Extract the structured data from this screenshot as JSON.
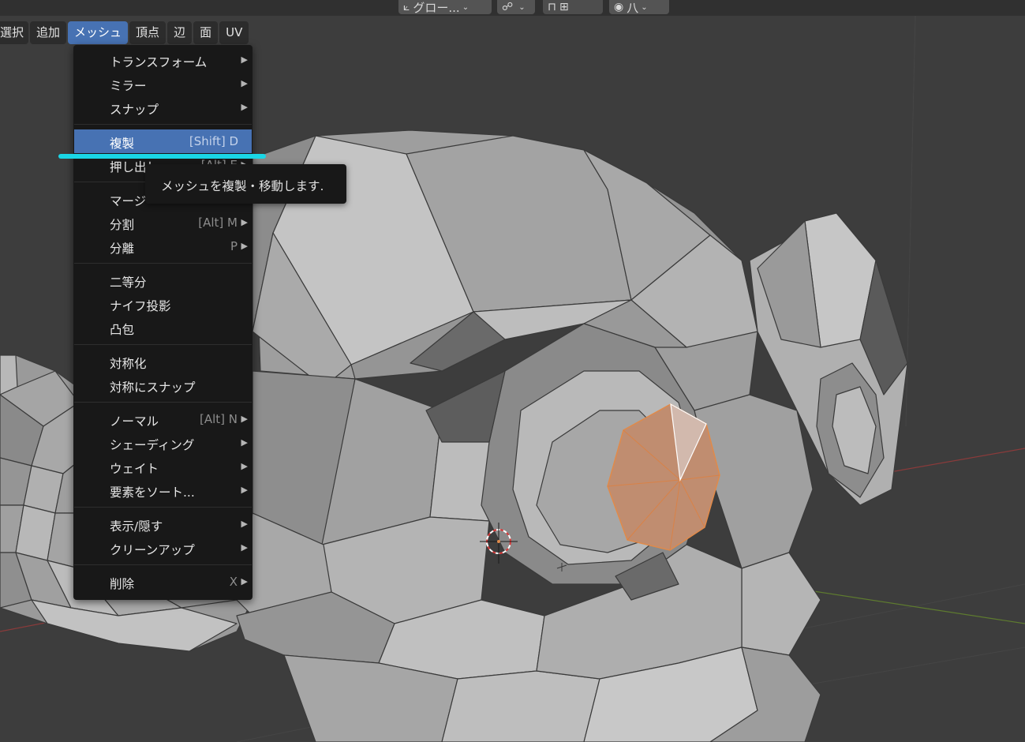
{
  "header": {
    "transform_orientation": "グロー...",
    "pivot_chevron": "⌄",
    "snap_chevron": "⌄",
    "proportional_label": "八"
  },
  "menubar": {
    "items": [
      {
        "label": "選択"
      },
      {
        "label": "追加"
      },
      {
        "label": "メッシュ",
        "active": true
      },
      {
        "label": "頂点"
      },
      {
        "label": "辺"
      },
      {
        "label": "面"
      },
      {
        "label": "UV"
      }
    ]
  },
  "mesh_menu": {
    "items": [
      {
        "label": "トランスフォーム",
        "shortcut": "",
        "submenu": true
      },
      {
        "label": "ミラー",
        "shortcut": "",
        "submenu": true
      },
      {
        "label": "スナップ",
        "shortcut": "",
        "submenu": true
      },
      {
        "label": "複製",
        "shortcut": "[Shift] D",
        "submenu": false,
        "highlighted": true
      },
      {
        "label": "押し出し",
        "shortcut": "[Alt] E",
        "submenu": true
      },
      {
        "label": "マージ",
        "shortcut": "M",
        "submenu": true
      },
      {
        "label": "分割",
        "shortcut": "[Alt] M",
        "submenu": true
      },
      {
        "label": "分離",
        "shortcut": "P",
        "submenu": true
      },
      {
        "label": "二等分",
        "shortcut": "",
        "submenu": false
      },
      {
        "label": "ナイフ投影",
        "shortcut": "",
        "submenu": false
      },
      {
        "label": "凸包",
        "shortcut": "",
        "submenu": false
      },
      {
        "label": "対称化",
        "shortcut": "",
        "submenu": false
      },
      {
        "label": "対称にスナップ",
        "shortcut": "",
        "submenu": false
      },
      {
        "label": "ノーマル",
        "shortcut": "[Alt] N",
        "submenu": true
      },
      {
        "label": "シェーディング",
        "shortcut": "",
        "submenu": true
      },
      {
        "label": "ウェイト",
        "shortcut": "",
        "submenu": true
      },
      {
        "label": "要素をソート...",
        "shortcut": "",
        "submenu": true
      },
      {
        "label": "表示/隠す",
        "shortcut": "",
        "submenu": true
      },
      {
        "label": "クリーンアップ",
        "shortcut": "",
        "submenu": true
      },
      {
        "label": "削除",
        "shortcut": "X",
        "submenu": true
      }
    ]
  },
  "tooltip": {
    "text": "メッシュを複製・移動します."
  },
  "colors": {
    "menu_bg": "#181818",
    "highlight": "#4772b3",
    "selection_orange": "#e08a4a",
    "annotation_cyan": "#1ad6e6"
  },
  "icons": [
    "transform-orientation-icon",
    "pivot-icon",
    "snap-icon",
    "proportional-edit-icon",
    "submenu-arrow-icon",
    "3d-cursor-icon"
  ]
}
